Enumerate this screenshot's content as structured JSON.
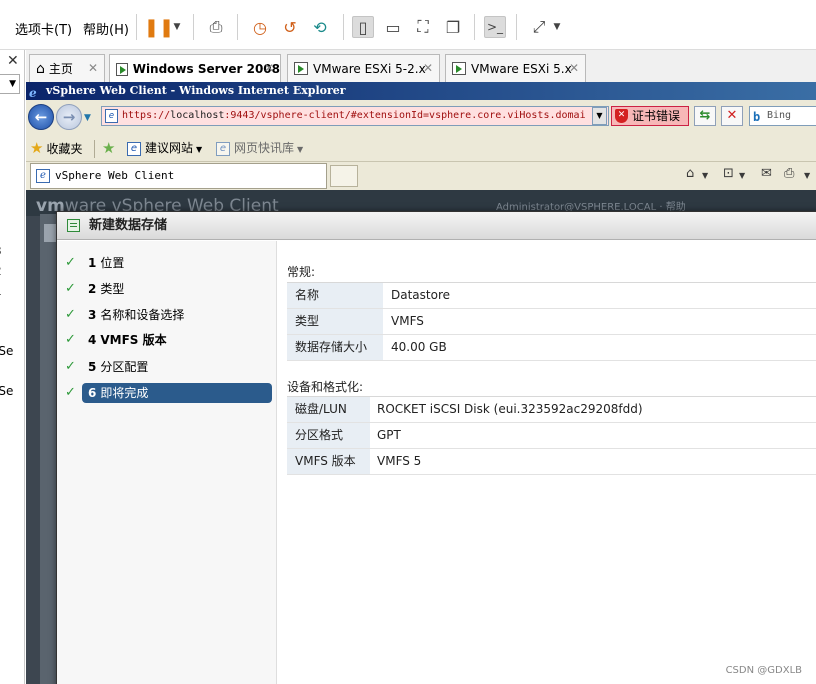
{
  "vmware": {
    "menu": {
      "tabs_label": "选项卡(T)",
      "help_label": "帮助(H)"
    }
  },
  "library": {
    "fragments": [
      "3",
      "2",
      "1",
      "-Se",
      "r",
      "-Se"
    ]
  },
  "tabs": [
    {
      "label": "主页",
      "active": false
    },
    {
      "label": "Windows Server 2008",
      "active": true
    },
    {
      "label": "VMware ESXi 5-2.x",
      "active": false
    },
    {
      "label": "VMware ESXi 5.x",
      "active": false
    }
  ],
  "ie": {
    "title": "vSphere Web Client - Windows Internet Explorer",
    "address_prefix": "https://",
    "address_host": "localhost",
    "address_rest": ":9443/vsphere-client/#extensionId=vsphere.core.viHosts.domai",
    "cert_error": "证书错误",
    "search_placeholder": "Bing",
    "favorites_label": "收藏夹",
    "suggested_sites": "建议网站",
    "web_slice_gallery": "网页快讯库",
    "tab_title": "vSphere Web Client"
  },
  "vsphere": {
    "logo_vm": "vm",
    "logo_ware": "ware",
    "logo_product": "vSphere Web Client",
    "user_text": "Administrator@VSPHERE.LOCAL",
    "help_text": "帮助"
  },
  "dialog": {
    "title": "新建数据存储",
    "steps": [
      {
        "num": "1",
        "label": "位置"
      },
      {
        "num": "2",
        "label": "类型"
      },
      {
        "num": "3",
        "label": "名称和设备选择"
      },
      {
        "num": "4",
        "label": "VMFS 版本"
      },
      {
        "num": "5",
        "label": "分区配置"
      },
      {
        "num": "6",
        "label": "即将完成"
      }
    ],
    "current_step": 6,
    "general": {
      "title": "常规:",
      "rows": [
        {
          "key": "名称",
          "value": "Datastore"
        },
        {
          "key": "类型",
          "value": "VMFS"
        },
        {
          "key": "数据存储大小",
          "value": "40.00 GB"
        }
      ]
    },
    "device": {
      "title": "设备和格式化:",
      "rows": [
        {
          "key": "磁盘/LUN",
          "value": "ROCKET iSCSI Disk (eui.323592ac29208fdd)"
        },
        {
          "key": "分区格式",
          "value": "GPT"
        },
        {
          "key": "VMFS 版本",
          "value": "VMFS 5"
        }
      ]
    }
  },
  "watermark": "CSDN @GDXLB",
  "colors": {
    "ie_title_start": "#0a246a",
    "ie_title_end": "#3a6ea5",
    "cert_error_bg": "#f7b7b7",
    "address_bg": "#ffe0e0",
    "step_selected": "#2b5b8c",
    "check_green": "#2e9a3a",
    "kv_key_bg": "#e8eef4"
  }
}
